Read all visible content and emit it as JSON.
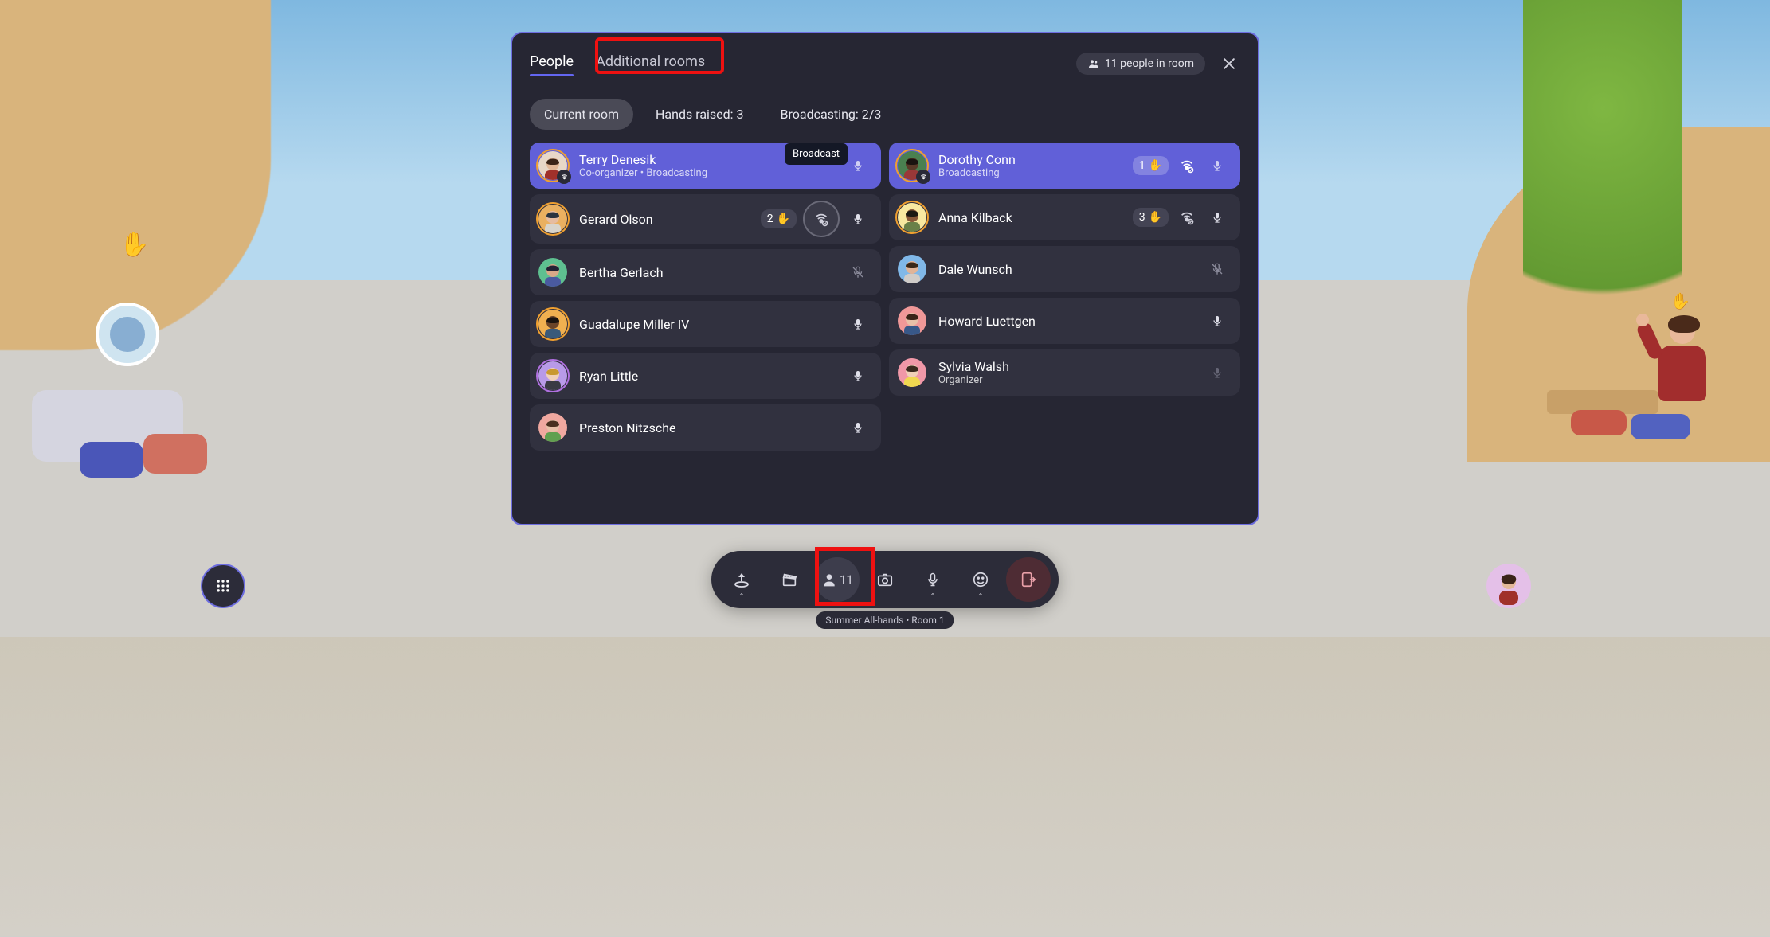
{
  "tabs": {
    "people": "People",
    "additional": "Additional rooms"
  },
  "roomBadge": {
    "count": 11,
    "text": "11 people in room"
  },
  "filters": {
    "current": "Current room",
    "hands": "Hands raised: 3",
    "broadcast": "Broadcasting: 2/3"
  },
  "tooltip": "Broadcast",
  "left": [
    {
      "name": "Terry Denesik",
      "sub": "Co-organizer • Broadcasting",
      "accent": true,
      "hand": null,
      "broadcastIcon": false,
      "mic": "on-accent",
      "ring": "orange",
      "subIcon": true,
      "bg": "#e8d8c8",
      "skin": "#e2b898",
      "hair": "#3a2418",
      "shirt": "#a0302a"
    },
    {
      "name": "Gerard Olson",
      "sub": null,
      "accent": false,
      "hand": "2",
      "broadcastIcon": "highlight",
      "mic": "on",
      "ring": "orange",
      "bg": "#eab060",
      "skin": "#e6bca0",
      "hair": "#2a3440",
      "shirt": "#d8d4cc"
    },
    {
      "name": "Bertha Gerlach",
      "sub": null,
      "accent": false,
      "hand": null,
      "broadcastIcon": false,
      "mic": "muted",
      "ring": null,
      "bg": "#5ec090",
      "skin": "#d8a888",
      "hair": "#222234",
      "shirt": "#4a5aa0"
    },
    {
      "name": "Guadalupe Miller IV",
      "sub": null,
      "accent": false,
      "hand": null,
      "broadcastIcon": false,
      "mic": "on",
      "ring": "orange",
      "bg": "#f0b050",
      "skin": "#6a4428",
      "hair": "#1a1410",
      "shirt": "#3a5a7a"
    },
    {
      "name": "Ryan Little",
      "sub": null,
      "accent": false,
      "hand": null,
      "broadcastIcon": false,
      "mic": "on",
      "ring": "purple",
      "bg": "#b89ae8",
      "skin": "#f0d0b8",
      "hair": "#c89830",
      "shirt": "#3a3a44"
    },
    {
      "name": "Preston Nitzsche",
      "sub": null,
      "accent": false,
      "hand": null,
      "broadcastIcon": false,
      "mic": "on",
      "ring": null,
      "bg": "#f0a8a0",
      "skin": "#e8c0a8",
      "hair": "#4a3020",
      "shirt": "#60a050"
    }
  ],
  "right": [
    {
      "name": "Dorothy Conn",
      "sub": "Broadcasting",
      "accent": true,
      "hand": "1",
      "broadcastIcon": "accent",
      "mic": "on-accent",
      "ring": "orange",
      "subIcon": true,
      "bg": "#4a8050",
      "skin": "#5a3a28",
      "hair": "#1a1410",
      "shirt": "#9a3838"
    },
    {
      "name": "Anna Kilback",
      "sub": null,
      "accent": false,
      "hand": "3",
      "broadcastIcon": "plain",
      "mic": "on",
      "ring": "orange",
      "bg": "#f8e8a0",
      "skin": "#885838",
      "hair": "#1a1812",
      "shirt": "#6a8048"
    },
    {
      "name": "Dale Wunsch",
      "sub": null,
      "accent": false,
      "hand": null,
      "broadcastIcon": false,
      "mic": "muted",
      "ring": null,
      "bg": "#80b8e8",
      "skin": "#e0b498",
      "hair": "#3a2818",
      "shirt": "#d0ccc8"
    },
    {
      "name": "Howard Luettgen",
      "sub": null,
      "accent": false,
      "hand": null,
      "broadcastIcon": false,
      "mic": "on",
      "ring": null,
      "bg": "#f09898",
      "skin": "#e8c0a8",
      "hair": "#3a2418",
      "shirt": "#385888"
    },
    {
      "name": "Sylvia Walsh",
      "sub": "Organizer",
      "accent": false,
      "hand": null,
      "broadcastIcon": false,
      "mic": "on-dim",
      "ring": null,
      "bg": "#f098a8",
      "skin": "#f0d0b8",
      "hair": "#3a2a20",
      "shirt": "#f0d850"
    }
  ],
  "toolbar": {
    "peopleCount": "11"
  },
  "roomLabel": "Summer All-hands • Room 1"
}
